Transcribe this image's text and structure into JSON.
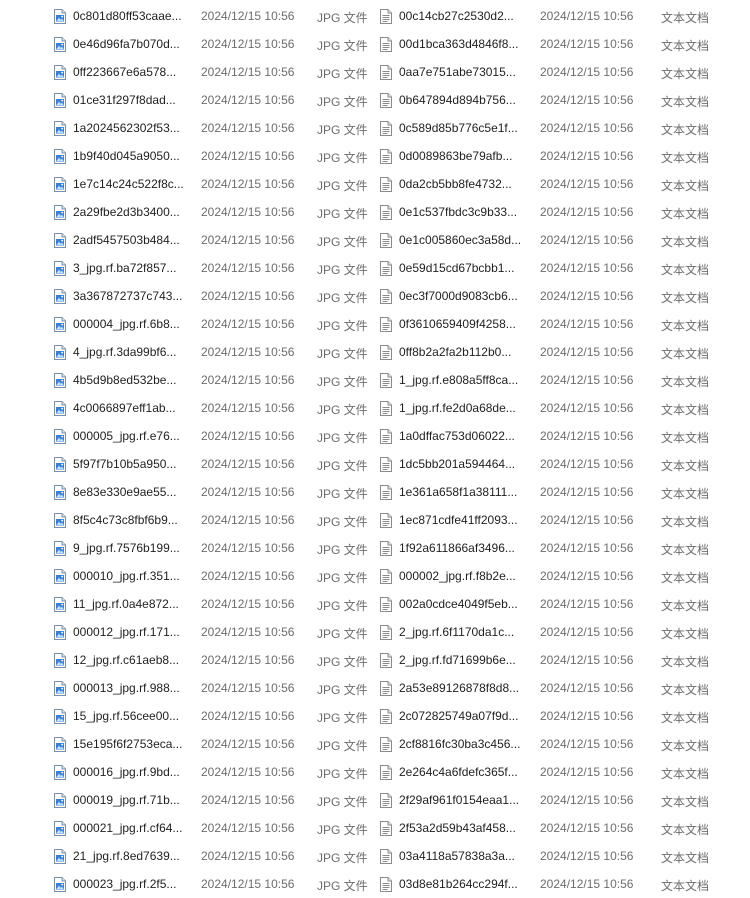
{
  "left_column": {
    "icon": "jpg-image-icon",
    "files": [
      {
        "name": "0c801d80ff53caae...",
        "modified": "2024/12/15 10:56",
        "type": "JPG 文件"
      },
      {
        "name": "0e46d96fa7b070d...",
        "modified": "2024/12/15 10:56",
        "type": "JPG 文件"
      },
      {
        "name": "0ff223667e6a578...",
        "modified": "2024/12/15 10:56",
        "type": "JPG 文件"
      },
      {
        "name": "01ce31f297f8dad...",
        "modified": "2024/12/15 10:56",
        "type": "JPG 文件"
      },
      {
        "name": "1a2024562302f53...",
        "modified": "2024/12/15 10:56",
        "type": "JPG 文件"
      },
      {
        "name": "1b9f40d045a9050...",
        "modified": "2024/12/15 10:56",
        "type": "JPG 文件"
      },
      {
        "name": "1e7c14c24c522f8c...",
        "modified": "2024/12/15 10:56",
        "type": "JPG 文件"
      },
      {
        "name": "2a29fbe2d3b3400...",
        "modified": "2024/12/15 10:56",
        "type": "JPG 文件"
      },
      {
        "name": "2adf5457503b484...",
        "modified": "2024/12/15 10:56",
        "type": "JPG 文件"
      },
      {
        "name": "3_jpg.rf.ba72f857...",
        "modified": "2024/12/15 10:56",
        "type": "JPG 文件"
      },
      {
        "name": "3a367872737c743...",
        "modified": "2024/12/15 10:56",
        "type": "JPG 文件"
      },
      {
        "name": "000004_jpg.rf.6b8...",
        "modified": "2024/12/15 10:56",
        "type": "JPG 文件"
      },
      {
        "name": "4_jpg.rf.3da99bf6...",
        "modified": "2024/12/15 10:56",
        "type": "JPG 文件"
      },
      {
        "name": "4b5d9b8ed532be...",
        "modified": "2024/12/15 10:56",
        "type": "JPG 文件"
      },
      {
        "name": "4c0066897eff1ab...",
        "modified": "2024/12/15 10:56",
        "type": "JPG 文件"
      },
      {
        "name": "000005_jpg.rf.e76...",
        "modified": "2024/12/15 10:56",
        "type": "JPG 文件"
      },
      {
        "name": "5f97f7b10b5a950...",
        "modified": "2024/12/15 10:56",
        "type": "JPG 文件"
      },
      {
        "name": "8e83e330e9ae55...",
        "modified": "2024/12/15 10:56",
        "type": "JPG 文件"
      },
      {
        "name": "8f5c4c73c8fbf6b9...",
        "modified": "2024/12/15 10:56",
        "type": "JPG 文件"
      },
      {
        "name": "9_jpg.rf.7576b199...",
        "modified": "2024/12/15 10:56",
        "type": "JPG 文件"
      },
      {
        "name": "000010_jpg.rf.351...",
        "modified": "2024/12/15 10:56",
        "type": "JPG 文件"
      },
      {
        "name": "11_jpg.rf.0a4e872...",
        "modified": "2024/12/15 10:56",
        "type": "JPG 文件"
      },
      {
        "name": "000012_jpg.rf.171...",
        "modified": "2024/12/15 10:56",
        "type": "JPG 文件"
      },
      {
        "name": "12_jpg.rf.c61aeb8...",
        "modified": "2024/12/15 10:56",
        "type": "JPG 文件"
      },
      {
        "name": "000013_jpg.rf.988...",
        "modified": "2024/12/15 10:56",
        "type": "JPG 文件"
      },
      {
        "name": "15_jpg.rf.56cee00...",
        "modified": "2024/12/15 10:56",
        "type": "JPG 文件"
      },
      {
        "name": "15e195f6f2753eca...",
        "modified": "2024/12/15 10:56",
        "type": "JPG 文件"
      },
      {
        "name": "000016_jpg.rf.9bd...",
        "modified": "2024/12/15 10:56",
        "type": "JPG 文件"
      },
      {
        "name": "000019_jpg.rf.71b...",
        "modified": "2024/12/15 10:56",
        "type": "JPG 文件"
      },
      {
        "name": "000021_jpg.rf.cf64...",
        "modified": "2024/12/15 10:56",
        "type": "JPG 文件"
      },
      {
        "name": "21_jpg.rf.8ed7639...",
        "modified": "2024/12/15 10:56",
        "type": "JPG 文件"
      },
      {
        "name": "000023_jpg.rf.2f5...",
        "modified": "2024/12/15 10:56",
        "type": "JPG 文件"
      }
    ]
  },
  "right_column": {
    "icon": "text-document-icon",
    "files": [
      {
        "name": "00c14cb27c2530d2...",
        "modified": "2024/12/15 10:56",
        "type": "文本文档"
      },
      {
        "name": "00d1bca363d4846f8...",
        "modified": "2024/12/15 10:56",
        "type": "文本文档"
      },
      {
        "name": "0aa7e751abe73015...",
        "modified": "2024/12/15 10:56",
        "type": "文本文档"
      },
      {
        "name": "0b647894d894b756...",
        "modified": "2024/12/15 10:56",
        "type": "文本文档"
      },
      {
        "name": "0c589d85b776c5e1f...",
        "modified": "2024/12/15 10:56",
        "type": "文本文档"
      },
      {
        "name": "0d0089863be79afb...",
        "modified": "2024/12/15 10:56",
        "type": "文本文档"
      },
      {
        "name": "0da2cb5bb8fe4732...",
        "modified": "2024/12/15 10:56",
        "type": "文本文档"
      },
      {
        "name": "0e1c537fbdc3c9b33...",
        "modified": "2024/12/15 10:56",
        "type": "文本文档"
      },
      {
        "name": "0e1c005860ec3a58d...",
        "modified": "2024/12/15 10:56",
        "type": "文本文档"
      },
      {
        "name": "0e59d15cd67bcbb1...",
        "modified": "2024/12/15 10:56",
        "type": "文本文档"
      },
      {
        "name": "0ec3f7000d9083cb6...",
        "modified": "2024/12/15 10:56",
        "type": "文本文档"
      },
      {
        "name": "0f3610659409f4258...",
        "modified": "2024/12/15 10:56",
        "type": "文本文档"
      },
      {
        "name": "0ff8b2a2fa2b112b0...",
        "modified": "2024/12/15 10:56",
        "type": "文本文档"
      },
      {
        "name": "1_jpg.rf.e808a5ff8ca...",
        "modified": "2024/12/15 10:56",
        "type": "文本文档"
      },
      {
        "name": "1_jpg.rf.fe2d0a68de...",
        "modified": "2024/12/15 10:56",
        "type": "文本文档"
      },
      {
        "name": "1a0dffac753d06022...",
        "modified": "2024/12/15 10:56",
        "type": "文本文档"
      },
      {
        "name": "1dc5bb201a594464...",
        "modified": "2024/12/15 10:56",
        "type": "文本文档"
      },
      {
        "name": "1e361a658f1a38111...",
        "modified": "2024/12/15 10:56",
        "type": "文本文档"
      },
      {
        "name": "1ec871cdfe41ff2093...",
        "modified": "2024/12/15 10:56",
        "type": "文本文档"
      },
      {
        "name": "1f92a611866af3496...",
        "modified": "2024/12/15 10:56",
        "type": "文本文档"
      },
      {
        "name": "000002_jpg.rf.f8b2e...",
        "modified": "2024/12/15 10:56",
        "type": "文本文档"
      },
      {
        "name": "002a0cdce4049f5eb...",
        "modified": "2024/12/15 10:56",
        "type": "文本文档"
      },
      {
        "name": "2_jpg.rf.6f1170da1c...",
        "modified": "2024/12/15 10:56",
        "type": "文本文档"
      },
      {
        "name": "2_jpg.rf.fd71699b6e...",
        "modified": "2024/12/15 10:56",
        "type": "文本文档"
      },
      {
        "name": "2a53e89126878f8d8...",
        "modified": "2024/12/15 10:56",
        "type": "文本文档"
      },
      {
        "name": "2c072825749a07f9d...",
        "modified": "2024/12/15 10:56",
        "type": "文本文档"
      },
      {
        "name": "2cf8816fc30ba3c456...",
        "modified": "2024/12/15 10:56",
        "type": "文本文档"
      },
      {
        "name": "2e264c4a6fdefc365f...",
        "modified": "2024/12/15 10:56",
        "type": "文本文档"
      },
      {
        "name": "2f29af961f0154eaa1...",
        "modified": "2024/12/15 10:56",
        "type": "文本文档"
      },
      {
        "name": "2f53a2d59b43af458...",
        "modified": "2024/12/15 10:56",
        "type": "文本文档"
      },
      {
        "name": "03a4118a57838a3a...",
        "modified": "2024/12/15 10:56",
        "type": "文本文档"
      },
      {
        "name": "03d8e81b264cc294f...",
        "modified": "2024/12/15 10:56",
        "type": "文本文档"
      }
    ]
  }
}
